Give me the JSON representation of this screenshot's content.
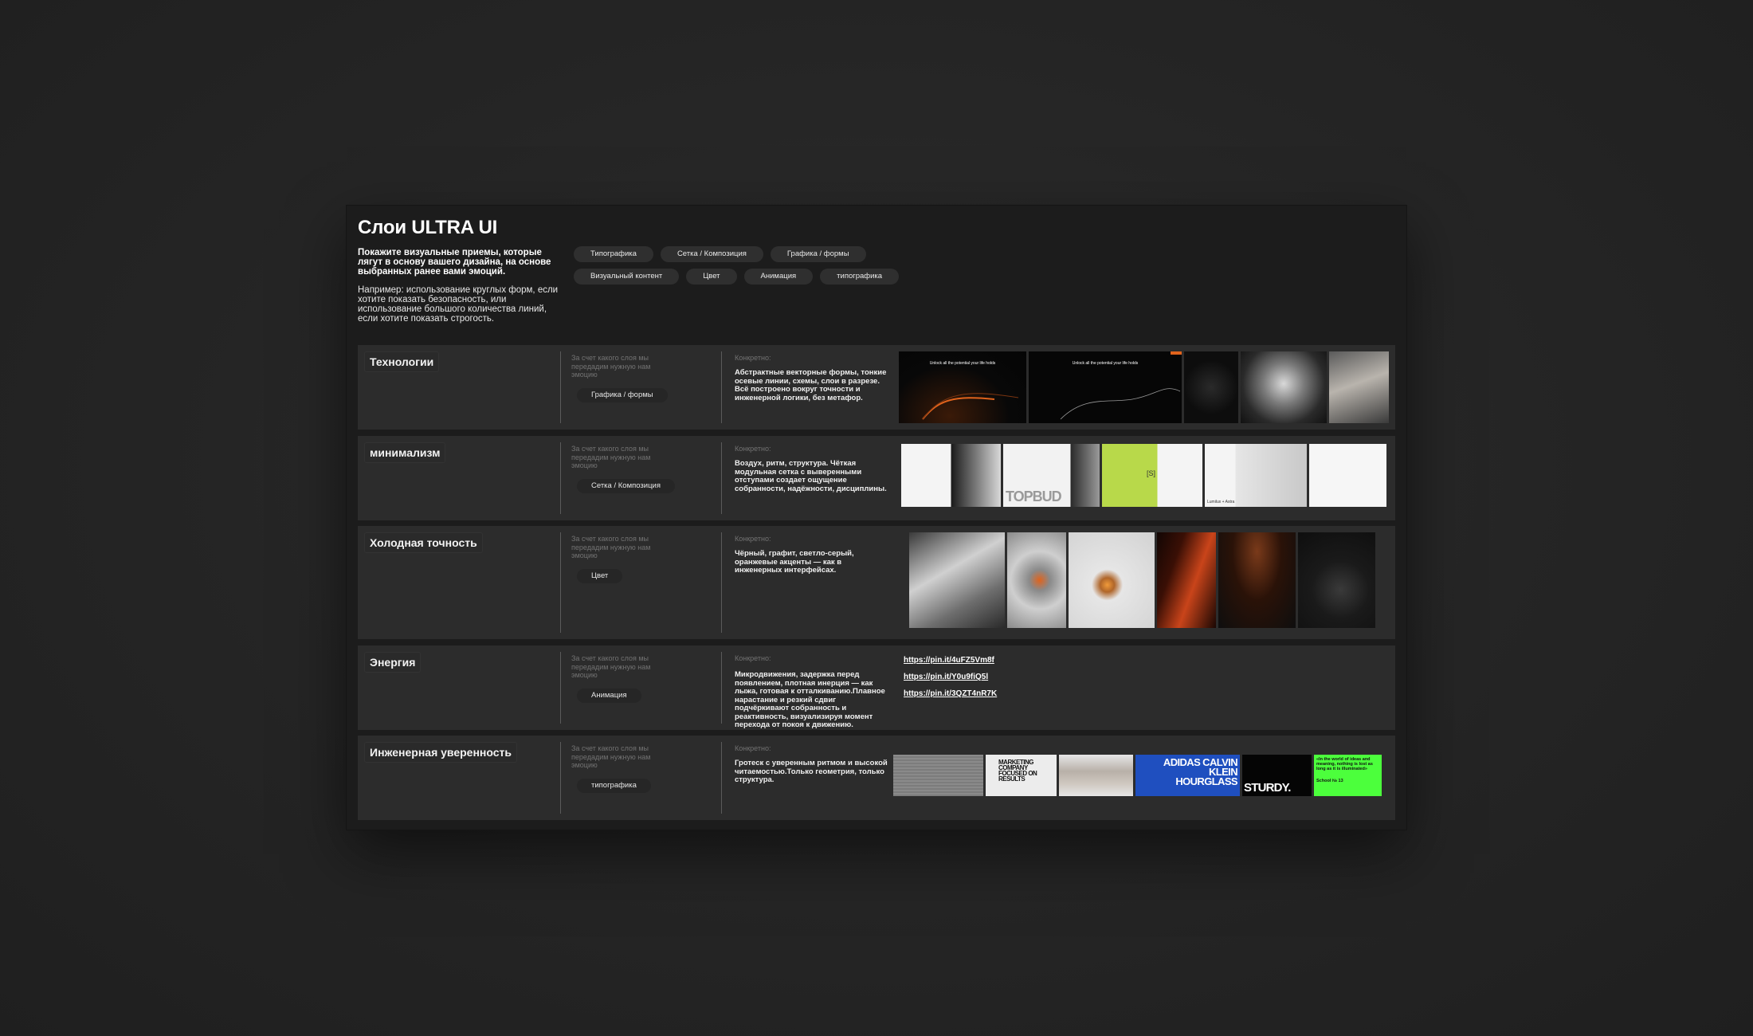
{
  "board": {
    "title": "Слои ULTRA UI",
    "lead": "Покажите визуальные приемы, которые лягут в основу вашего дизайна, на основе выбранных ранее вами эмоций.",
    "note": "Например: использование круглых форм, если хотите показать безопасность, или использование большого количества линий, если хотите показать строгость.",
    "chips": [
      "Типографика",
      "Сетка / Композиция",
      "Графика / формы",
      "Визуальный контент",
      "Цвет",
      "Анимация",
      "типографика"
    ]
  },
  "rows": [
    {
      "title": "Технологии",
      "hint": "За счет какого слоя мы передадим нужную нам эмоцию",
      "tag": "Графика / формы",
      "label": "Конкретно:",
      "text": "Абстрактные векторные формы, тонкие осевые линии, схемы, слои в разрезе. Всё построено вокруг точности и инженерной логики, без метафор.",
      "thumb_texts": [
        "Unlock all the potential your life holds",
        "Unlock all the potential your life holds"
      ]
    },
    {
      "title": "минимализм",
      "hint": "За счет какого слоя мы передадим нужную нам эмоцию",
      "tag": "Сетка / Композиция",
      "label": "Конкретно:",
      "text": "Воздух, ритм, структура. Чёткая модульная сетка с выверенными отступами создает ощущение собранности, надёжности, дисциплины.",
      "thumb_texts": [
        "TOPBUD",
        "[S]",
        "Lumilux + Astra"
      ]
    },
    {
      "title": "Холодная точность",
      "hint": "За счет какого слоя мы передадим нужную нам эмоцию",
      "tag": "Цвет",
      "label": "Конкретно:",
      "text": "Чёрный, графит, светло-серый, оранжевые акценты — как в инженерных интерфейсах."
    },
    {
      "title": "Энергия",
      "hint": "За счет какого слоя мы передадим нужную нам эмоцию",
      "tag": "Анимация",
      "label": "Конкретно:",
      "text": "Микродвижения, задержка перед появлением, плотная инерция — как лыжа, готовая к отталкиванию.Плавное нарастание и резкий сдвиг подчёркивают собранность и реактивность, визуализируя момент перехода от покоя к движению.",
      "links": [
        "https://pin.it/4uFZ5Vm8f",
        "https://pin.it/Y0u9fiQ5l",
        "https://pin.it/3QZT4nR7K"
      ]
    },
    {
      "title": "Инженерная уверенность",
      "hint": "За счет какого слоя мы передадим нужную нам эмоцию",
      "tag": "типографика",
      "label": "Конкретно:",
      "text": "Гротеск с уверенным ритмом и высокой читаемостью.Только геометрия, только структура.",
      "thumb_texts": [
        "MARKETING COMPANY FOCUSED ON RESULTS",
        "ADIDAS CALVIN KLEIN HOURGLASS",
        "STURDY.",
        "«In the world of ideas and meaning, nothing is lost as long as it is illuminated»",
        "School № 13"
      ]
    }
  ],
  "colors": {
    "accent_orange": "#e0631c",
    "accent_green": "#4cff3c",
    "accent_blue": "#1f4fbf"
  }
}
